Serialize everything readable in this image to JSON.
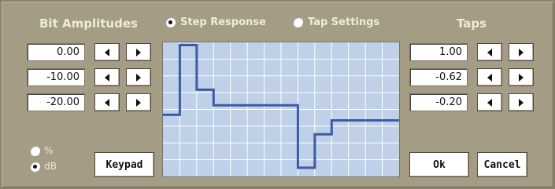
{
  "bit_amplitudes": {
    "title": "Bit Amplitudes",
    "values": [
      "0.00",
      "-10.00",
      "-20.00"
    ],
    "unit_options": [
      {
        "label": "%",
        "selected": false
      },
      {
        "label": "dB",
        "selected": true
      }
    ],
    "keypad_label": "Keypad"
  },
  "view_mode": {
    "step_response_label": "Step Response",
    "tap_settings_label": "Tap Settings",
    "selected": "step_response"
  },
  "taps": {
    "title": "Taps",
    "values": [
      "1.00",
      "-0.62",
      "-0.20"
    ],
    "ok_label": "Ok",
    "cancel_label": "Cancel"
  },
  "step_response": {
    "trace_color": "#3d5ba3",
    "grid_color": "#ffffff",
    "background_color": "#bfd0e9",
    "grid_visible": true,
    "levels": [
      0,
      1.25,
      0.45,
      0.17,
      0.17,
      0.17,
      0.17,
      -0.95,
      -0.35,
      -0.1,
      -0.1,
      -0.1,
      -0.1
    ]
  },
  "icons": {
    "decrement": "triangle-left-icon",
    "increment": "triangle-right-icon"
  }
}
